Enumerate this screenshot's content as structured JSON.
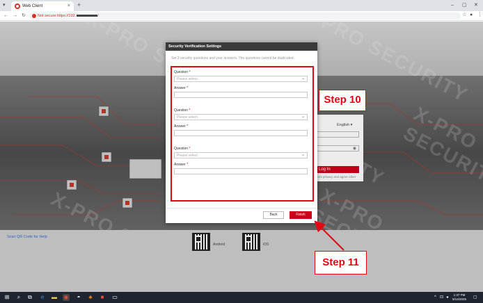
{
  "browser": {
    "tab_title": "Web Client",
    "tab_close": "×",
    "new_tab": "+",
    "not_secure": "Not secure",
    "url": "https://192."
  },
  "login": {
    "language": "English",
    "login_button": "Log In",
    "privacy_text": "..ent privacy and agree other"
  },
  "footer": {
    "qr_help": "Scan QR Code for Help",
    "android": "Android",
    "ios": "iOS"
  },
  "modal": {
    "title": "Security Verification Settings",
    "hint": "Set 3 security questions and your answers. The questions cannot be duplicated.",
    "question_label": "Question",
    "answer_label": "Answer",
    "required_mark": "*",
    "select_placeholder": "Please select.",
    "back": "Back",
    "finish": "Finish"
  },
  "steps": {
    "step10": "Step 10",
    "step11": "Step 11"
  },
  "watermark": "X-PRO SECURITY",
  "taskbar": {
    "time": "1:37 PM",
    "date": "5/14/2025"
  },
  "colors": {
    "accent": "#d0021b",
    "highlight": "#e30613"
  }
}
